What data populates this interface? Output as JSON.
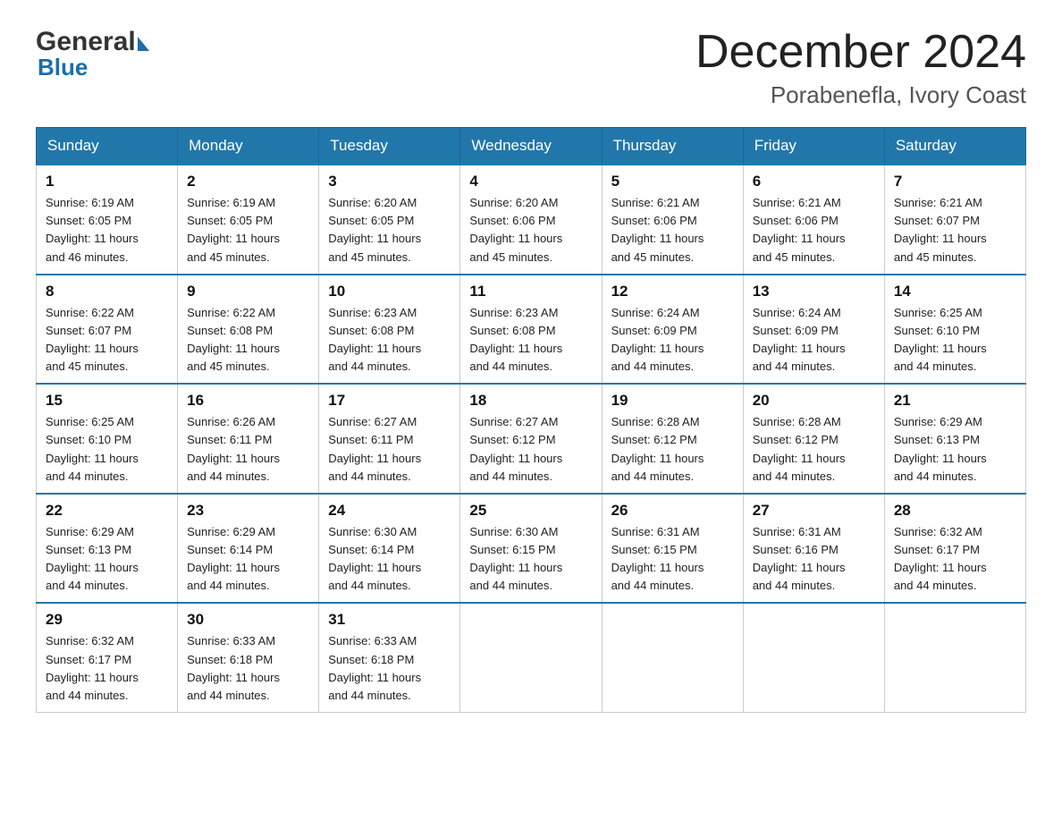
{
  "logo": {
    "general": "General",
    "blue": "Blue"
  },
  "title": "December 2024",
  "subtitle": "Porabenefla, Ivory Coast",
  "weekdays": [
    "Sunday",
    "Monday",
    "Tuesday",
    "Wednesday",
    "Thursday",
    "Friday",
    "Saturday"
  ],
  "weeks": [
    [
      {
        "day": "1",
        "sunrise": "6:19 AM",
        "sunset": "6:05 PM",
        "daylight": "11 hours and 46 minutes."
      },
      {
        "day": "2",
        "sunrise": "6:19 AM",
        "sunset": "6:05 PM",
        "daylight": "11 hours and 45 minutes."
      },
      {
        "day": "3",
        "sunrise": "6:20 AM",
        "sunset": "6:05 PM",
        "daylight": "11 hours and 45 minutes."
      },
      {
        "day": "4",
        "sunrise": "6:20 AM",
        "sunset": "6:06 PM",
        "daylight": "11 hours and 45 minutes."
      },
      {
        "day": "5",
        "sunrise": "6:21 AM",
        "sunset": "6:06 PM",
        "daylight": "11 hours and 45 minutes."
      },
      {
        "day": "6",
        "sunrise": "6:21 AM",
        "sunset": "6:06 PM",
        "daylight": "11 hours and 45 minutes."
      },
      {
        "day": "7",
        "sunrise": "6:21 AM",
        "sunset": "6:07 PM",
        "daylight": "11 hours and 45 minutes."
      }
    ],
    [
      {
        "day": "8",
        "sunrise": "6:22 AM",
        "sunset": "6:07 PM",
        "daylight": "11 hours and 45 minutes."
      },
      {
        "day": "9",
        "sunrise": "6:22 AM",
        "sunset": "6:08 PM",
        "daylight": "11 hours and 45 minutes."
      },
      {
        "day": "10",
        "sunrise": "6:23 AM",
        "sunset": "6:08 PM",
        "daylight": "11 hours and 44 minutes."
      },
      {
        "day": "11",
        "sunrise": "6:23 AM",
        "sunset": "6:08 PM",
        "daylight": "11 hours and 44 minutes."
      },
      {
        "day": "12",
        "sunrise": "6:24 AM",
        "sunset": "6:09 PM",
        "daylight": "11 hours and 44 minutes."
      },
      {
        "day": "13",
        "sunrise": "6:24 AM",
        "sunset": "6:09 PM",
        "daylight": "11 hours and 44 minutes."
      },
      {
        "day": "14",
        "sunrise": "6:25 AM",
        "sunset": "6:10 PM",
        "daylight": "11 hours and 44 minutes."
      }
    ],
    [
      {
        "day": "15",
        "sunrise": "6:25 AM",
        "sunset": "6:10 PM",
        "daylight": "11 hours and 44 minutes."
      },
      {
        "day": "16",
        "sunrise": "6:26 AM",
        "sunset": "6:11 PM",
        "daylight": "11 hours and 44 minutes."
      },
      {
        "day": "17",
        "sunrise": "6:27 AM",
        "sunset": "6:11 PM",
        "daylight": "11 hours and 44 minutes."
      },
      {
        "day": "18",
        "sunrise": "6:27 AM",
        "sunset": "6:12 PM",
        "daylight": "11 hours and 44 minutes."
      },
      {
        "day": "19",
        "sunrise": "6:28 AM",
        "sunset": "6:12 PM",
        "daylight": "11 hours and 44 minutes."
      },
      {
        "day": "20",
        "sunrise": "6:28 AM",
        "sunset": "6:12 PM",
        "daylight": "11 hours and 44 minutes."
      },
      {
        "day": "21",
        "sunrise": "6:29 AM",
        "sunset": "6:13 PM",
        "daylight": "11 hours and 44 minutes."
      }
    ],
    [
      {
        "day": "22",
        "sunrise": "6:29 AM",
        "sunset": "6:13 PM",
        "daylight": "11 hours and 44 minutes."
      },
      {
        "day": "23",
        "sunrise": "6:29 AM",
        "sunset": "6:14 PM",
        "daylight": "11 hours and 44 minutes."
      },
      {
        "day": "24",
        "sunrise": "6:30 AM",
        "sunset": "6:14 PM",
        "daylight": "11 hours and 44 minutes."
      },
      {
        "day": "25",
        "sunrise": "6:30 AM",
        "sunset": "6:15 PM",
        "daylight": "11 hours and 44 minutes."
      },
      {
        "day": "26",
        "sunrise": "6:31 AM",
        "sunset": "6:15 PM",
        "daylight": "11 hours and 44 minutes."
      },
      {
        "day": "27",
        "sunrise": "6:31 AM",
        "sunset": "6:16 PM",
        "daylight": "11 hours and 44 minutes."
      },
      {
        "day": "28",
        "sunrise": "6:32 AM",
        "sunset": "6:17 PM",
        "daylight": "11 hours and 44 minutes."
      }
    ],
    [
      {
        "day": "29",
        "sunrise": "6:32 AM",
        "sunset": "6:17 PM",
        "daylight": "11 hours and 44 minutes."
      },
      {
        "day": "30",
        "sunrise": "6:33 AM",
        "sunset": "6:18 PM",
        "daylight": "11 hours and 44 minutes."
      },
      {
        "day": "31",
        "sunrise": "6:33 AM",
        "sunset": "6:18 PM",
        "daylight": "11 hours and 44 minutes."
      },
      null,
      null,
      null,
      null
    ]
  ],
  "labels": {
    "sunrise": "Sunrise:",
    "sunset": "Sunset:",
    "daylight": "Daylight:"
  }
}
